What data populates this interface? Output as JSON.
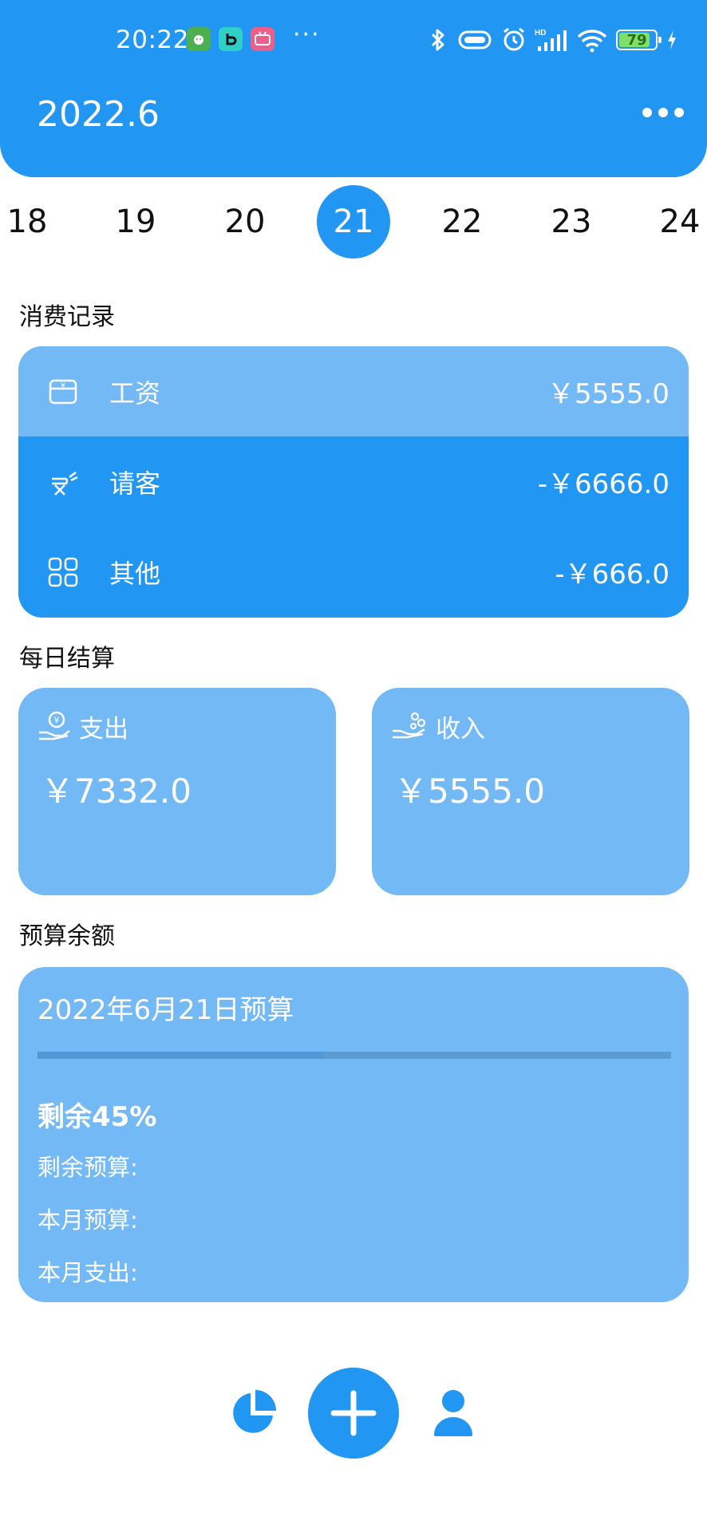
{
  "status_bar": {
    "time": "20:22",
    "more": "···",
    "battery": "79"
  },
  "header": {
    "title": "2022.6"
  },
  "dates": {
    "items": [
      "18",
      "19",
      "20",
      "21",
      "22",
      "23",
      "24"
    ],
    "selected": "21"
  },
  "records": {
    "title": "消费记录",
    "items": [
      {
        "icon": "wallet-icon",
        "label": "工资",
        "amount": "￥5555.0"
      },
      {
        "icon": "food-icon",
        "label": "请客",
        "amount": "-￥6666.0"
      },
      {
        "icon": "grid-icon",
        "label": "其他",
        "amount": "-￥666.0"
      }
    ]
  },
  "daily": {
    "title": "每日结算",
    "expense": {
      "icon": "hand-money-icon",
      "label": "支出",
      "value": "￥7332.0"
    },
    "income": {
      "icon": "hand-coins-icon",
      "label": "收入",
      "value": "￥5555.0"
    }
  },
  "budget": {
    "title": "预算余额",
    "card_title": "2022年6月21日预算",
    "remaining_text": "剩余45%",
    "remaining_fraction": 0.45,
    "remaining_budget_label": "剩余预算:",
    "month_budget_label": "本月预算:",
    "month_expense_label": "本月支出:"
  },
  "nav": {
    "stats_icon": "pie-chart-icon",
    "add_icon": "plus-icon",
    "profile_icon": "user-icon"
  },
  "colors": {
    "primary": "#2196F3",
    "light": "#73B9F5"
  }
}
